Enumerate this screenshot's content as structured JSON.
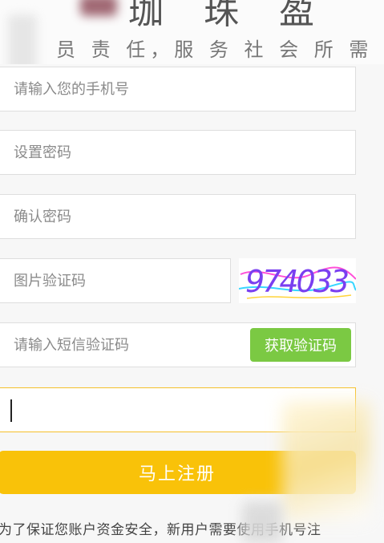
{
  "header": {
    "brand_title": "珈 珠 盈",
    "slogan": "员 责 任，服 务 社 会 所 需"
  },
  "form": {
    "phone_placeholder": "请输入您的手机号",
    "password_placeholder": "设置密码",
    "confirm_password_placeholder": "确认密码",
    "captcha_placeholder": "图片验证码",
    "captcha_text": "974033",
    "sms_code_placeholder": "请输入短信验证码",
    "get_code_label": "获取验证码",
    "extra_field_value": "",
    "register_label": "马上注册"
  },
  "notice": {
    "text": "为了保证您账户资金安全，新用户需要使用手机号注"
  },
  "colors": {
    "accent_yellow": "#f9c209",
    "focus_border": "#f5c02a",
    "green_button": "#7bc943",
    "page_background": "#f7f7f7"
  }
}
